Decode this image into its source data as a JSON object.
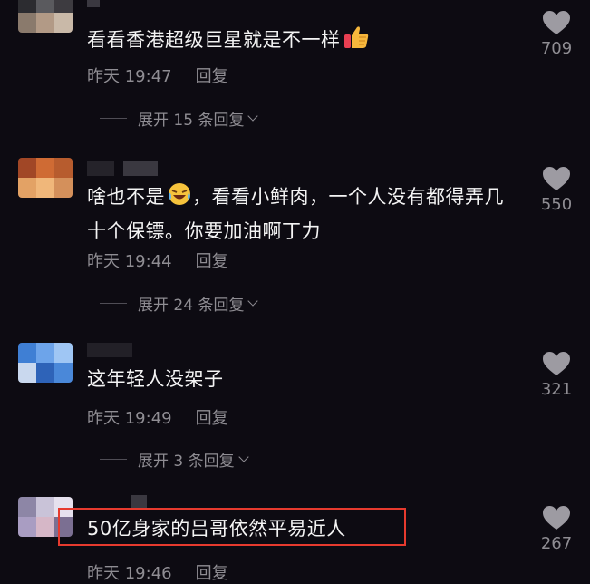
{
  "comments": [
    {
      "text": "看看香港超级巨星就是不一样",
      "emoji": "thumbs-up",
      "time": "昨天 19:47",
      "reply": "回复",
      "expand": "展开 15 条回复",
      "likes": "709"
    },
    {
      "text": "啥也不是",
      "emoji": "laughing-crying",
      "text2": "，看看小鲜肉，一个人没有都得弄几十个保镖。你要加油啊丁力",
      "time": "昨天 19:44",
      "reply": "回复",
      "expand": "展开 24 条回复",
      "likes": "550"
    },
    {
      "text": "这年轻人没架子",
      "time": "昨天 19:49",
      "reply": "回复",
      "expand": "展开 3 条回复",
      "likes": "321"
    },
    {
      "text": "50亿身家的吕哥依然平易近人",
      "time": "昨天 19:46",
      "reply": "回复",
      "likes": "267",
      "highlighted": true
    }
  ],
  "colors": {
    "background": "#0d0b12",
    "text": "#f4f4f4",
    "meta": "#8f8d93",
    "highlight_border": "#e63a2e"
  },
  "icons": [
    "heart-icon",
    "chevron-down-icon",
    "thumbs-up-emoji",
    "laughing-emoji"
  ]
}
